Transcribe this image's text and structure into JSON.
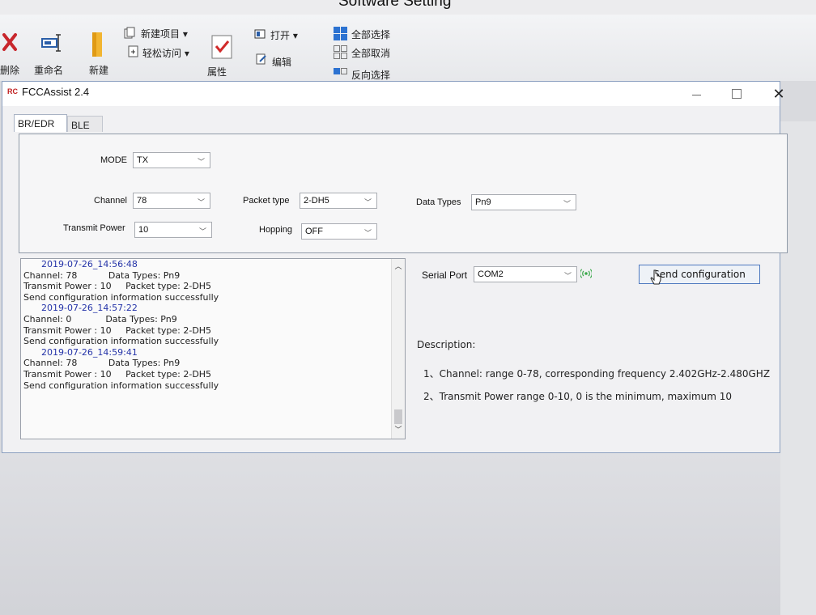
{
  "caption": "Software Setting",
  "ribbon": {
    "delete_label": "删除",
    "rename_label": "重命名",
    "new_label": "新建",
    "new_item_label": "新建项目 ▾",
    "easy_access_label": "轻松访问 ▾",
    "properties_label": "属性",
    "open_label": "打开 ▾",
    "edit_label": "编辑",
    "select_all_label": "全部选择",
    "select_none_label": "全部取消",
    "invert_selection_label": "反向选择"
  },
  "window": {
    "logo_text": "RC",
    "title": "FCCAssist 2.4",
    "tabs": [
      {
        "label": "BR/EDR",
        "active": true
      },
      {
        "label": "BLE",
        "active": false
      }
    ]
  },
  "config": {
    "mode_label": "MODE",
    "mode_value": "TX",
    "channel_label": "Channel",
    "channel_value": "78",
    "packet_type_label": "Packet type",
    "packet_type_value": "2-DH5",
    "data_types_label": "Data Types",
    "data_types_value": "Pn9",
    "transmit_power_label": "Transmit Power",
    "transmit_power_value": "10",
    "hopping_label": "Hopping",
    "hopping_value": "OFF"
  },
  "log": [
    {
      "type": "ts",
      "text": "2019-07-26_14:56:48"
    },
    {
      "type": "c",
      "text": "Channel: 78           Data Types: Pn9"
    },
    {
      "type": "c",
      "text": "Transmit Power : 10     Packet type: 2-DH5"
    },
    {
      "type": "c",
      "text": "Send configuration information successfully"
    },
    {
      "type": "ts",
      "text": "2019-07-26_14:57:22"
    },
    {
      "type": "c",
      "text": "Channel: 0            Data Types: Pn9"
    },
    {
      "type": "c",
      "text": "Transmit Power : 10     Packet type: 2-DH5"
    },
    {
      "type": "c",
      "text": "Send configuration information successfully"
    },
    {
      "type": "ts",
      "text": "2019-07-26_14:59:41"
    },
    {
      "type": "c",
      "text": "Channel: 78           Data Types: Pn9"
    },
    {
      "type": "c",
      "text": "Transmit Power : 10     Packet type: 2-DH5"
    },
    {
      "type": "c",
      "text": "Send configuration information successfully"
    }
  ],
  "serial": {
    "label": "Serial Port",
    "value": "COM2",
    "send_label": "Send configuration"
  },
  "description": {
    "title": "Description:",
    "lines": [
      "1、Channel: range 0-78, corresponding frequency 2.402GHz-2.480GHZ",
      "2、Transmit Power  range 0-10, 0 is the minimum, maximum 10"
    ]
  },
  "colors": {
    "timestamp": "#2433a8",
    "send_border": "#4e79bf",
    "signal": "#3aa84a"
  }
}
